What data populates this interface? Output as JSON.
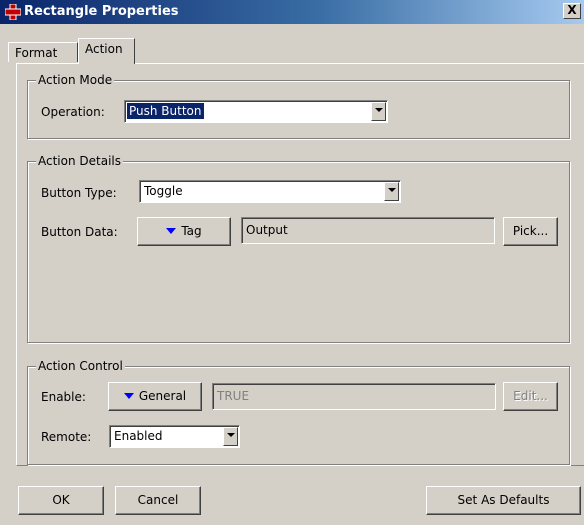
{
  "window": {
    "title": "Rectangle Properties",
    "close_label": "X",
    "icon": "rectangle-app-icon"
  },
  "tabs": [
    {
      "label": "Format",
      "active": false
    },
    {
      "label": "Action",
      "active": true
    }
  ],
  "action_mode": {
    "legend": "Action Mode",
    "operation_label": "Operation:",
    "operation_value": "Push Button"
  },
  "action_details": {
    "legend": "Action Details",
    "button_type_label": "Button Type:",
    "button_type_value": "Toggle",
    "button_data_label": "Button Data:",
    "tag_button_label": "Tag",
    "button_data_value": "Output",
    "pick_button_label": "Pick..."
  },
  "action_control": {
    "legend": "Action Control",
    "enable_label": "Enable:",
    "general_button_label": "General",
    "enable_value": "TRUE",
    "edit_button_label": "Edit...",
    "remote_label": "Remote:",
    "remote_value": "Enabled"
  },
  "footer": {
    "ok_label": "OK",
    "cancel_label": "Cancel",
    "set_defaults_label": "Set As Defaults"
  },
  "colors": {
    "titlebar_start": "#0a246a",
    "titlebar_end": "#a6caf0",
    "selection": "#0a246a",
    "dropdown_triangle": "#0000ff"
  }
}
